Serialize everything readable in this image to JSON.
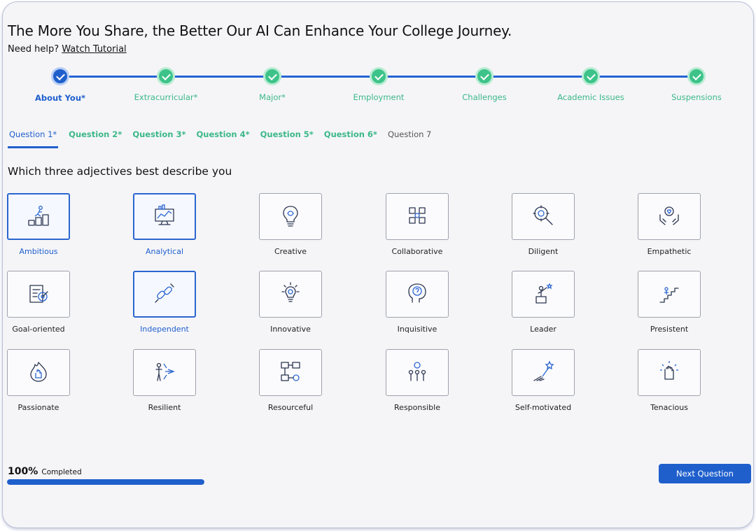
{
  "header": {
    "title": "The More You Share, the Better Our AI Can Enhance Your College Journey.",
    "help_text": "Need help?",
    "tutorial_link": "Watch Tutorial"
  },
  "stepper": [
    {
      "label": "About You*",
      "state": "active"
    },
    {
      "label": "Extracurricular*",
      "state": "complete"
    },
    {
      "label": "Major*",
      "state": "complete"
    },
    {
      "label": "Employment",
      "state": "complete"
    },
    {
      "label": "Challenges",
      "state": "complete"
    },
    {
      "label": "Academic Issues",
      "state": "complete"
    },
    {
      "label": "Suspensions",
      "state": "complete"
    }
  ],
  "tabs": [
    {
      "label": "Question 1*",
      "state": "active"
    },
    {
      "label": "Question 2*",
      "state": "done"
    },
    {
      "label": "Question 3*",
      "state": "done"
    },
    {
      "label": "Question 4*",
      "state": "done"
    },
    {
      "label": "Question 5*",
      "state": "done"
    },
    {
      "label": "Question 6*",
      "state": "done"
    },
    {
      "label": "Question 7",
      "state": "plain"
    }
  ],
  "question": "Which three adjectives best describe you",
  "options": [
    {
      "label": "Ambitious",
      "icon": "ambitious-icon",
      "selected": true
    },
    {
      "label": "Analytical",
      "icon": "analytical-icon",
      "selected": true
    },
    {
      "label": "Creative",
      "icon": "creative-icon",
      "selected": false
    },
    {
      "label": "Collaborative",
      "icon": "collaborative-icon",
      "selected": false
    },
    {
      "label": "Diligent",
      "icon": "diligent-icon",
      "selected": false
    },
    {
      "label": "Empathetic",
      "icon": "empathetic-icon",
      "selected": false
    },
    {
      "label": "Goal-oriented",
      "icon": "goal-oriented-icon",
      "selected": false
    },
    {
      "label": "Independent",
      "icon": "independent-icon",
      "selected": true
    },
    {
      "label": "Innovative",
      "icon": "innovative-icon",
      "selected": false
    },
    {
      "label": "Inquisitive",
      "icon": "inquisitive-icon",
      "selected": false
    },
    {
      "label": "Leader",
      "icon": "leader-icon",
      "selected": false
    },
    {
      "label": "Presistent",
      "icon": "persistent-icon",
      "selected": false
    },
    {
      "label": "Passionate",
      "icon": "passionate-icon",
      "selected": false
    },
    {
      "label": "Resilient",
      "icon": "resilient-icon",
      "selected": false
    },
    {
      "label": "Resourceful",
      "icon": "resourceful-icon",
      "selected": false
    },
    {
      "label": "Responsible",
      "icon": "responsible-icon",
      "selected": false
    },
    {
      "label": "Self-motivated",
      "icon": "self-motivated-icon",
      "selected": false
    },
    {
      "label": "Tenacious",
      "icon": "tenacious-icon",
      "selected": false
    }
  ],
  "progress": {
    "percent_text": "100%",
    "label": "Completed",
    "value": 1.0
  },
  "next_button": "Next Question",
  "colors": {
    "primary": "#1f5fcc",
    "success": "#3dc389",
    "border": "#9ea3ad"
  }
}
